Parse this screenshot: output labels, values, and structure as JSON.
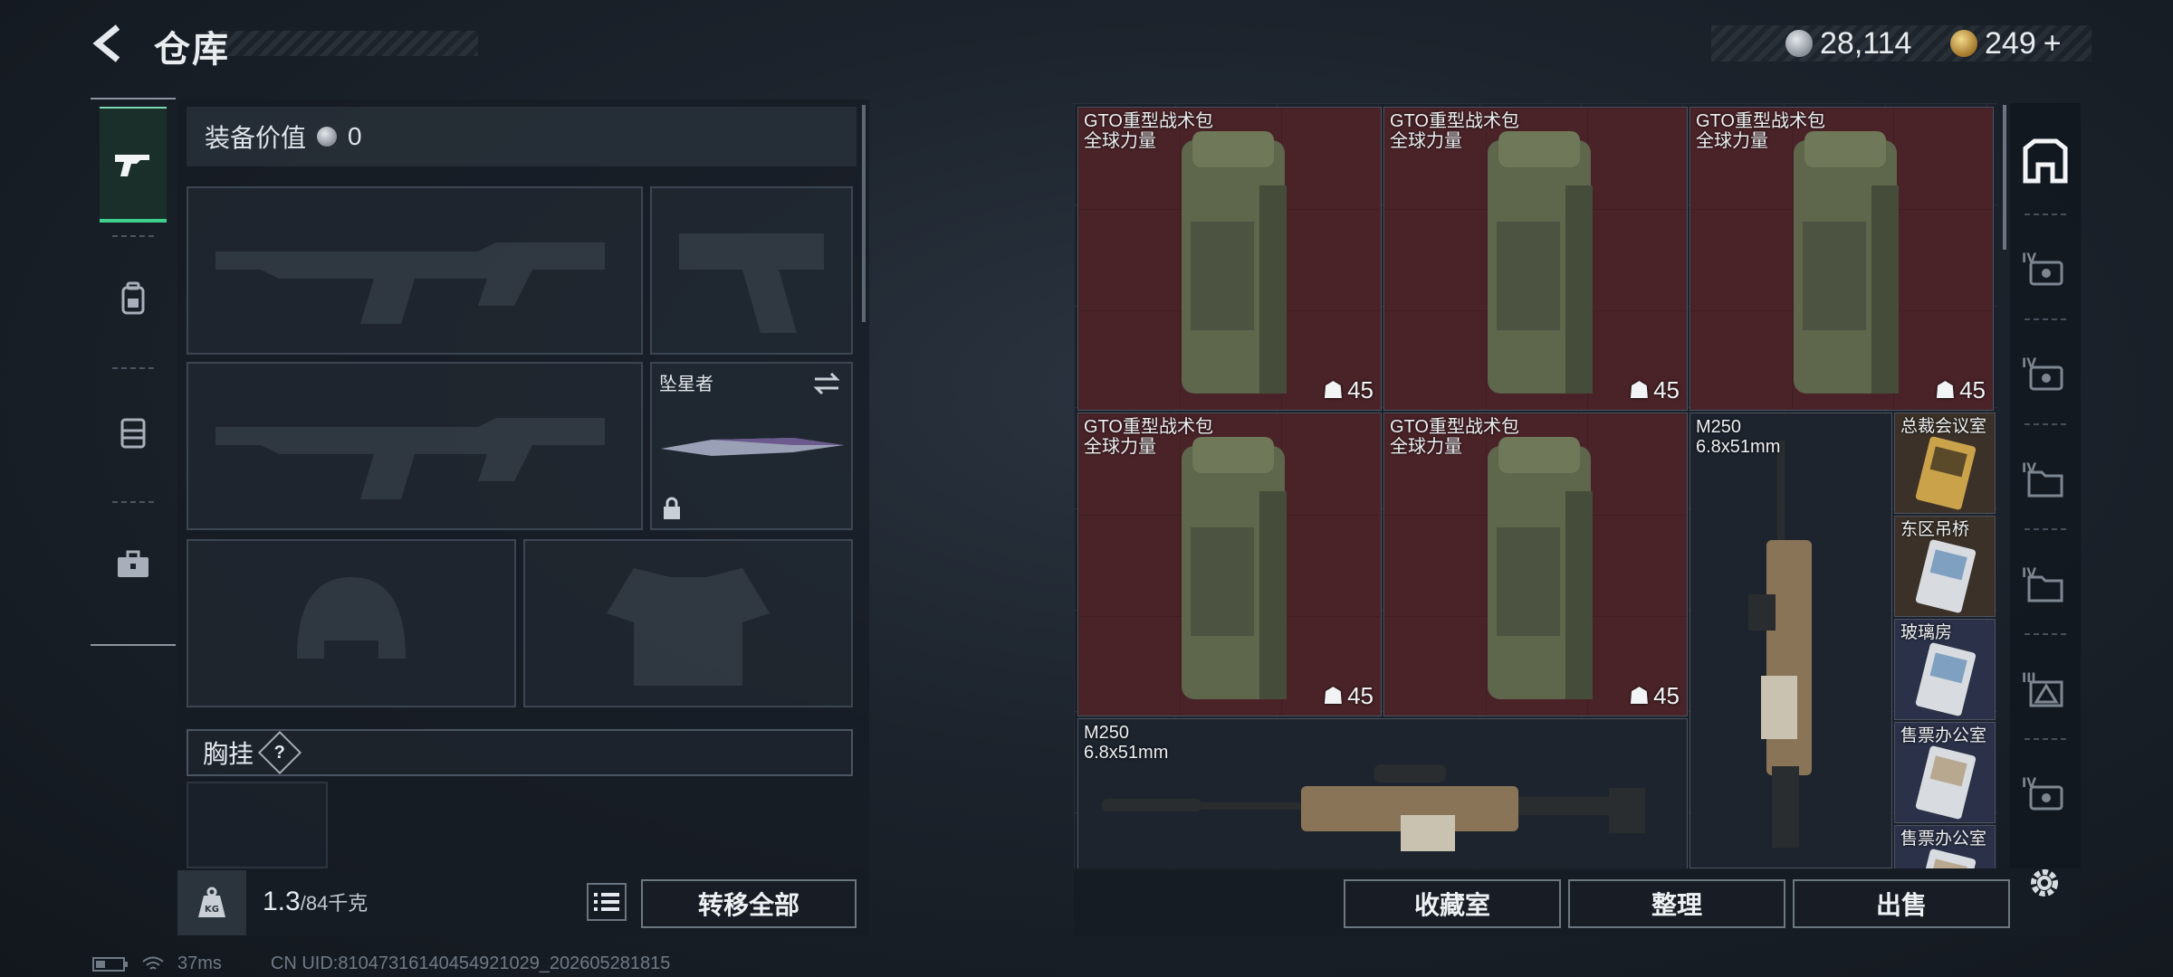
{
  "header": {
    "title": "仓库",
    "currency_silver": "28,114",
    "currency_gold": "249",
    "currency_gold_plus": "+"
  },
  "loadout": {
    "value_label": "装备价值",
    "value": "0",
    "sidearm_label": "坠星者",
    "chest_label": "胸挂",
    "chest_help": "?"
  },
  "capacity": {
    "current": "1.3",
    "max": "/84千克",
    "kg_icon_text": "KG",
    "transfer_all": "转移全部"
  },
  "stash": {
    "items": [
      {
        "name": "GTO重型战术包",
        "sub": "全球力量",
        "count": "45"
      },
      {
        "name": "GTO重型战术包",
        "sub": "全球力量",
        "count": "45"
      },
      {
        "name": "GTO重型战术包",
        "sub": "全球力量",
        "count": "45"
      },
      {
        "name": "GTO重型战术包",
        "sub": "全球力量",
        "count": "45"
      },
      {
        "name": "GTO重型战术包",
        "sub": "全球力量",
        "count": "45"
      },
      {
        "name": "M250",
        "sub": "6.8x51mm"
      },
      {
        "name": "M250",
        "sub": "6.8x51mm"
      },
      {
        "name": "总裁会议室"
      },
      {
        "name": "东区吊桥"
      },
      {
        "name": "玻璃房"
      },
      {
        "name": "售票办公室"
      },
      {
        "name": "售票办公室"
      }
    ],
    "buttons": {
      "collection": "收藏室",
      "sort": "整理",
      "sell": "出售"
    }
  },
  "footer": {
    "ping": "37ms",
    "uid": "CN UID:810473161404549210​29_202605281815"
  },
  "colors": {
    "accent_green": "#3fd08e",
    "item_red": "#4a2328"
  },
  "icons": [
    "back-arrow-icon",
    "rifle-icon",
    "backpack-icon",
    "rig-icon",
    "toolbox-icon",
    "safe-icon",
    "settings-icon",
    "list-icon",
    "lock-icon",
    "swap-icon",
    "kg-weight-icon",
    "wifi-icon",
    "battery-icon"
  ]
}
